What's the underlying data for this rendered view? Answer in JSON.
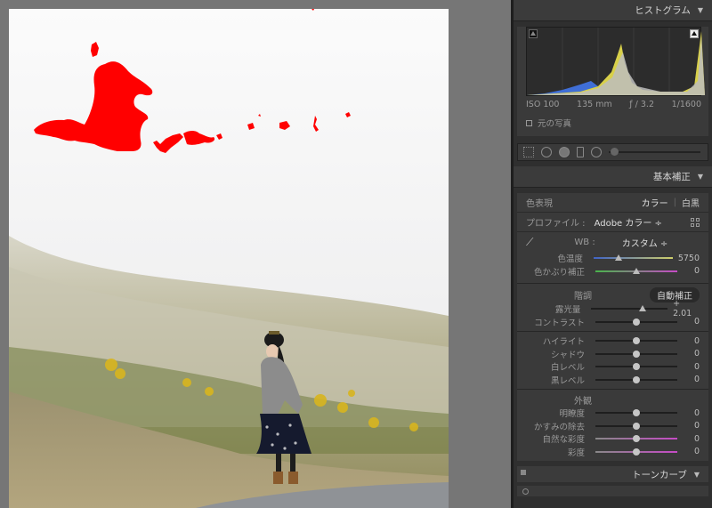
{
  "histogram_panel": {
    "title": "ヒストグラム",
    "iso": "ISO 100",
    "focal_length": "135 mm",
    "aperture": "ƒ / 3.2",
    "shutter": "1/1600",
    "original_photo_label": "元の写真"
  },
  "basic_panel": {
    "title": "基本補正",
    "treatment_label": "色表現",
    "treatment_color": "カラー",
    "treatment_bw": "白黒",
    "profile_label": "プロファイル :",
    "profile_value": "Adobe カラー ÷",
    "wb_label": "WB :",
    "wb_value": "カスタム ÷",
    "temp_label": "色温度",
    "temp_value": "5750",
    "temp_pos": 0.32,
    "tint_label": "色かぶり補正",
    "tint_value": "0",
    "tint_pos": 0.5,
    "tone_label": "階調",
    "auto_label": "自動補正",
    "exposure_label": "露光量",
    "exposure_value": "+ 2.01",
    "exposure_pos": 0.67,
    "contrast_label": "コントラスト",
    "contrast_value": "0",
    "highlights_label": "ハイライト",
    "highlights_value": "0",
    "shadows_label": "シャドウ",
    "shadows_value": "0",
    "whites_label": "白レベル",
    "whites_value": "0",
    "blacks_label": "黒レベル",
    "blacks_value": "0",
    "presence_label": "外観",
    "clarity_label": "明瞭度",
    "clarity_value": "0",
    "dehaze_label": "かすみの除去",
    "dehaze_value": "0",
    "vibrance_label": "自然な彩度",
    "vibrance_value": "0",
    "saturation_label": "彩度",
    "saturation_value": "0"
  },
  "tone_curve_panel": {
    "title": "トーンカーブ"
  },
  "colors": {
    "mask": "#ff0000",
    "panel_bg": "#2f2f2f",
    "canvas_bg": "#767676"
  }
}
